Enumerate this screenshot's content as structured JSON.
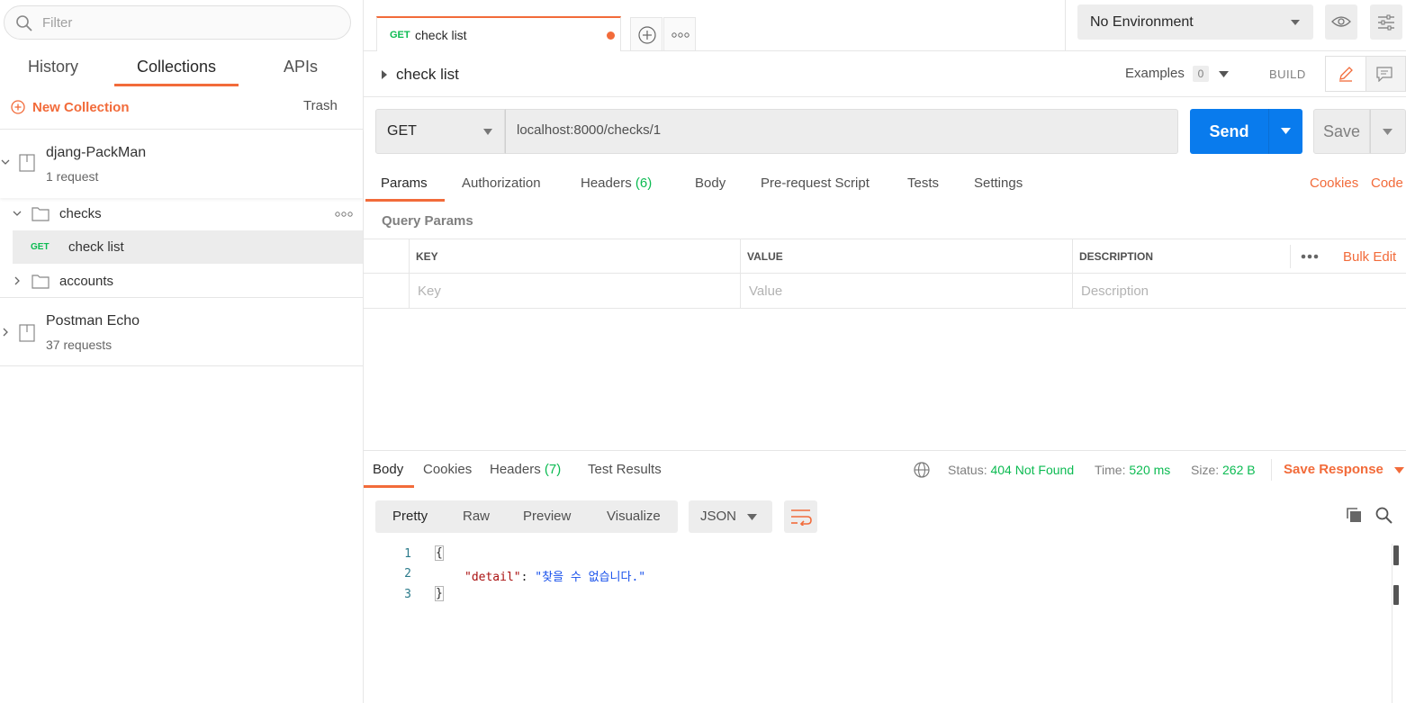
{
  "sidebar": {
    "filter_placeholder": "Filter",
    "tabs": [
      "History",
      "Collections",
      "APIs"
    ],
    "new_collection": "New Collection",
    "trash": "Trash",
    "collections": [
      {
        "name": "djang-PackMan",
        "sub": "1 request"
      },
      {
        "name": "Postman Echo",
        "sub": "37 requests"
      }
    ],
    "folders": [
      "checks",
      "accounts"
    ],
    "request": {
      "method": "GET",
      "name": "check list"
    }
  },
  "topbar": {
    "tab": {
      "method": "GET",
      "title": "check list"
    },
    "environment": "No Environment"
  },
  "request": {
    "name": "check list",
    "examples_label": "Examples",
    "examples_count": "0",
    "build_label": "BUILD",
    "method": "GET",
    "url": "localhost:8000/checks/1",
    "send": "Send",
    "save": "Save",
    "tabs": {
      "params": "Params",
      "authorization": "Authorization",
      "headers": "Headers",
      "headers_count": "(6)",
      "body": "Body",
      "prerequest": "Pre-request Script",
      "tests": "Tests",
      "settings": "Settings"
    },
    "cookies": "Cookies",
    "code": "Code",
    "query_params": "Query Params",
    "table": {
      "headers": [
        "KEY",
        "VALUE",
        "DESCRIPTION"
      ],
      "placeholders": [
        "Key",
        "Value",
        "Description"
      ],
      "bulk_edit": "Bulk Edit"
    }
  },
  "response": {
    "tabs": {
      "body": "Body",
      "cookies": "Cookies",
      "headers": "Headers",
      "headers_count": "(7)",
      "test_results": "Test Results"
    },
    "status_label": "Status:",
    "status": "404 Not Found",
    "time_label": "Time:",
    "time": "520 ms",
    "size_label": "Size:",
    "size": "262 B",
    "save_response": "Save Response",
    "views": [
      "Pretty",
      "Raw",
      "Preview",
      "Visualize"
    ],
    "format": "JSON",
    "body_lines": {
      "line_numbers": [
        "1",
        "2",
        "3"
      ],
      "open": "{",
      "key": "\"detail\"",
      "colon": ": ",
      "value": "\"찾을 수 없습니다.\"",
      "close": "}"
    }
  },
  "colors": {
    "accent": "#f26b3a",
    "send": "#097bed",
    "success": "#0cbb52"
  }
}
